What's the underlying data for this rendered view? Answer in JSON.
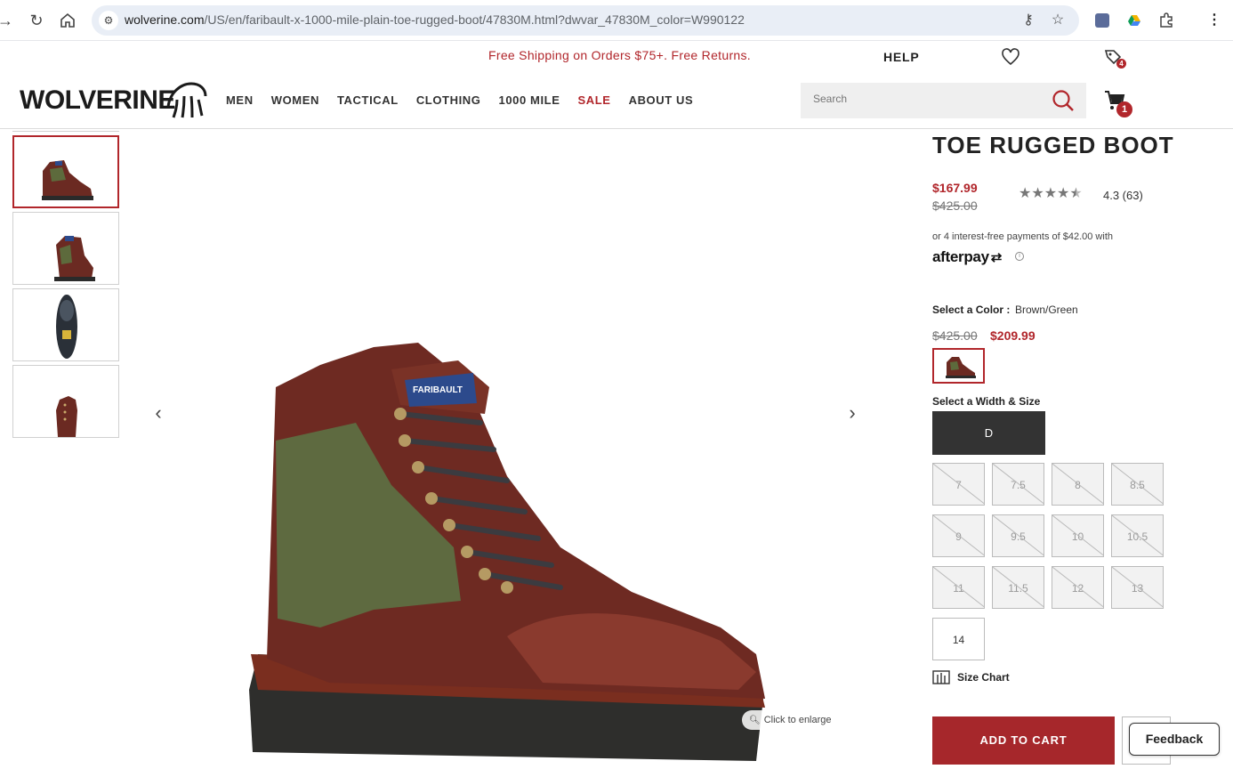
{
  "browser": {
    "url_host": "wolverine.com",
    "url_path": "/US/en/faribault-x-1000-mile-plain-toe-rugged-boot/47830M.html?dwvar_47830M_color=W990122"
  },
  "header": {
    "promo": "Free Shipping on Orders $75+. Free Returns.",
    "help": "HELP",
    "logo": "WOLVERINE",
    "orders_badge": "4",
    "nav": [
      "MEN",
      "WOMEN",
      "TACTICAL",
      "CLOTHING",
      "1000 MILE",
      "SALE",
      "ABOUT US"
    ],
    "search_placeholder": "Search",
    "cart_count": "1"
  },
  "gallery": {
    "enlarge_label": "Click to enlarge",
    "selected_thumbnail": 1
  },
  "product": {
    "title": "TOE RUGGED BOOT",
    "sale_price": "$167.99",
    "original_price": "$425.00",
    "rating_value": 4.3,
    "rating_text": "4.3 (63)",
    "afterpay_text": "or 4 interest-free payments of $42.00 with",
    "afterpay_logo": "afterpay",
    "color_label": "Select a Color :",
    "color_value": "Brown/Green",
    "color_original_price": "$425.00",
    "color_sale_price": "$209.99",
    "size_label": "Select a Width & Size",
    "width": "D",
    "sizes": [
      {
        "label": "7",
        "available": false
      },
      {
        "label": "7.5",
        "available": false
      },
      {
        "label": "8",
        "available": false
      },
      {
        "label": "8.5",
        "available": false
      },
      {
        "label": "9",
        "available": false
      },
      {
        "label": "9.5",
        "available": false
      },
      {
        "label": "10",
        "available": false
      },
      {
        "label": "10.5",
        "available": false
      },
      {
        "label": "11",
        "available": false
      },
      {
        "label": "11.5",
        "available": false
      },
      {
        "label": "12",
        "available": false
      },
      {
        "label": "13",
        "available": false
      },
      {
        "label": "14",
        "available": true
      }
    ],
    "size_chart": "Size Chart",
    "add_to_cart": "ADD TO CART"
  },
  "feedback": "Feedback",
  "colors": {
    "brand_red": "#b1262b",
    "button_red": "#a6272b"
  }
}
